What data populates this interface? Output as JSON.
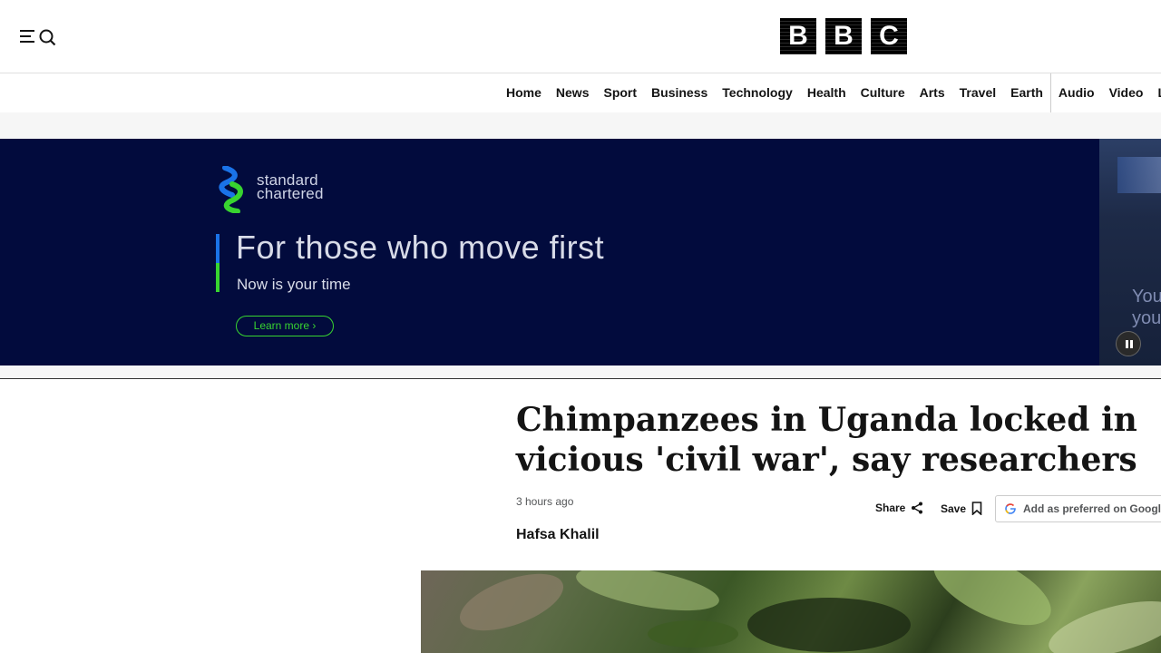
{
  "header": {
    "logo_letters": [
      "B",
      "B",
      "C"
    ]
  },
  "nav": {
    "items": [
      "Home",
      "News",
      "Sport",
      "Business",
      "Technology",
      "Health",
      "Culture",
      "Arts",
      "Travel",
      "Earth",
      "Audio",
      "Video",
      "Live"
    ]
  },
  "ad": {
    "brand_line1": "standard",
    "brand_line2": "chartered",
    "headline": "For those who move first",
    "subline": "Now is your time",
    "cta": "Learn more ›",
    "side_text_line1": "You",
    "side_text_line2": "you"
  },
  "article": {
    "headline": "Chimpanzees in Uganda locked in vicious 'civil war', say researchers",
    "timestamp": "3 hours ago",
    "share_label": "Share",
    "save_label": "Save",
    "preferred_label": "Add as preferred on Google",
    "author": "Hafsa Khalil"
  },
  "colors": {
    "ad_background": "#020b3d",
    "accent_green": "#38d430",
    "accent_blue": "#1a73e8"
  }
}
